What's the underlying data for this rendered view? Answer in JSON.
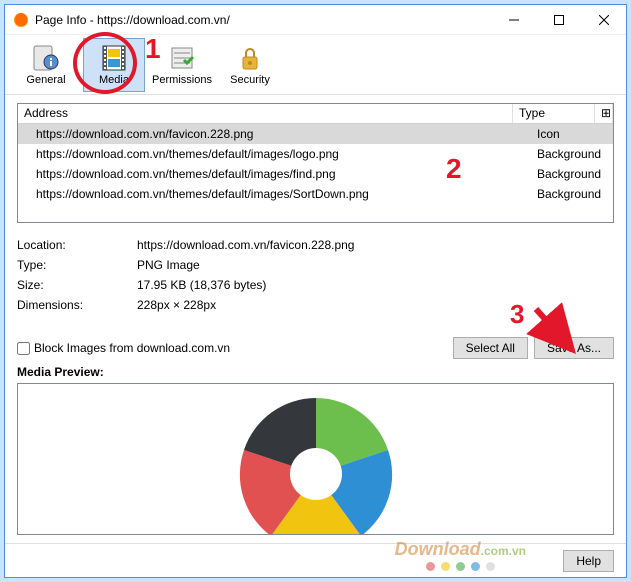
{
  "window": {
    "title": "Page Info - https://download.com.vn/"
  },
  "tabs": {
    "general": "General",
    "media": "Media",
    "permissions": "Permissions",
    "security": "Security"
  },
  "annotations": {
    "a1": "1",
    "a2": "2",
    "a3": "3"
  },
  "list": {
    "headers": {
      "address": "Address",
      "type": "Type",
      "last": "⊞"
    },
    "rows": [
      {
        "address": "https://download.com.vn/favicon.228.png",
        "type": "Icon"
      },
      {
        "address": "https://download.com.vn/themes/default/images/logo.png",
        "type": "Background"
      },
      {
        "address": "https://download.com.vn/themes/default/images/find.png",
        "type": "Background"
      },
      {
        "address": "https://download.com.vn/themes/default/images/SortDown.png",
        "type": "Background"
      }
    ]
  },
  "details": {
    "location_label": "Location:",
    "location_value": "https://download.com.vn/favicon.228.png",
    "type_label": "Type:",
    "type_value": "PNG Image",
    "size_label": "Size:",
    "size_value": "17.95 KB (18,376 bytes)",
    "dimensions_label": "Dimensions:",
    "dimensions_value": "228px × 228px"
  },
  "actions": {
    "block_label": "Block Images from download.com.vn",
    "select_all": "Select All",
    "save_as": "Save As..."
  },
  "preview": {
    "label": "Media Preview:"
  },
  "footer": {
    "help": "Help"
  },
  "watermark": {
    "text1": "Download",
    "text2": ".com.vn",
    "dots": [
      "#e25151",
      "#f1c40f",
      "#49aa49",
      "#2e8fd4",
      "#cccccc"
    ]
  },
  "logo_colors": {
    "green": "#6cbf4c",
    "blue": "#2e8fd4",
    "red": "#e25151",
    "yellow": "#f1c40f",
    "dark": "#34383c"
  }
}
